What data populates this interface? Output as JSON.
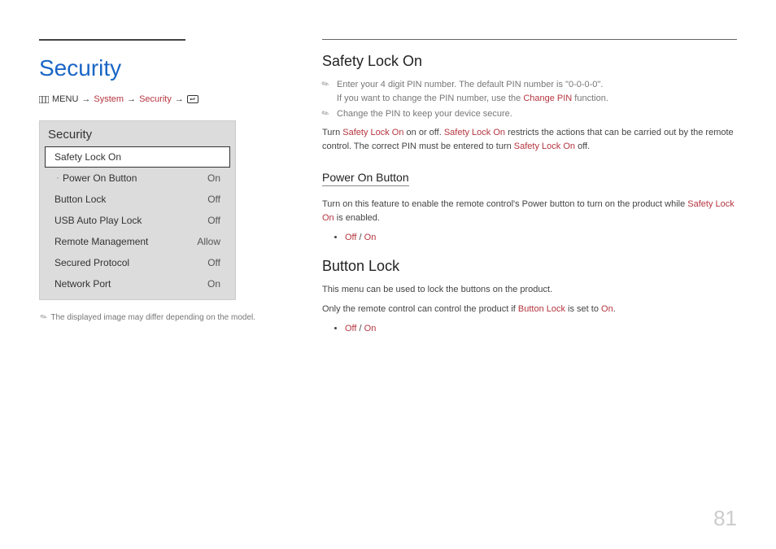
{
  "page_number": "81",
  "left": {
    "title": "Security",
    "breadcrumb": {
      "menu_label": "MENU",
      "arrow": "→",
      "system": "System",
      "security": "Security"
    },
    "menu": {
      "title": "Security",
      "rows": [
        {
          "label": "Safety Lock On",
          "value": "",
          "selected": true,
          "sub": false
        },
        {
          "label": "Power On Button",
          "value": "On",
          "selected": false,
          "sub": true
        },
        {
          "label": "Button Lock",
          "value": "Off",
          "selected": false,
          "sub": false
        },
        {
          "label": "USB Auto Play Lock",
          "value": "Off",
          "selected": false,
          "sub": false
        },
        {
          "label": "Remote Management",
          "value": "Allow",
          "selected": false,
          "sub": false
        },
        {
          "label": "Secured Protocol",
          "value": "Off",
          "selected": false,
          "sub": false
        },
        {
          "label": "Network Port",
          "value": "On",
          "selected": false,
          "sub": false
        }
      ]
    },
    "footnote": "The displayed image may differ depending on the model."
  },
  "right": {
    "safety_lock": {
      "heading": "Safety Lock On",
      "note1a": "Enter your 4 digit PIN number. The default PIN number is \"0-0-0-0\".",
      "note1b": "If you want to change the PIN number, use the ",
      "note1b_hl": "Change PIN",
      "note1b_tail": " function.",
      "note2": "Change the PIN to keep your device secure.",
      "body_pre": "Turn ",
      "body_hl1": "Safety Lock On",
      "body_mid1": " on or off. ",
      "body_hl2": "Safety Lock On",
      "body_mid2": " restricts the actions that can be carried out by the remote control. The correct PIN must be entered to turn ",
      "body_hl3": "Safety Lock On",
      "body_tail": " off."
    },
    "power_on": {
      "heading": "Power On Button",
      "body_pre": "Turn on this feature to enable the remote control's Power button to turn on the product while ",
      "body_hl": "Safety Lock On",
      "body_tail": " is enabled.",
      "bullet_off": "Off",
      "bullet_sep": " / ",
      "bullet_on": "On"
    },
    "button_lock": {
      "heading": "Button Lock",
      "body1": "This menu can be used to lock the buttons on the product.",
      "body2_pre": "Only the remote control can control the product if ",
      "body2_hl": "Button Lock",
      "body2_mid": " is set to ",
      "body2_hl2": "On",
      "body2_tail": ".",
      "bullet_off": "Off",
      "bullet_sep": " / ",
      "bullet_on": "On"
    }
  }
}
